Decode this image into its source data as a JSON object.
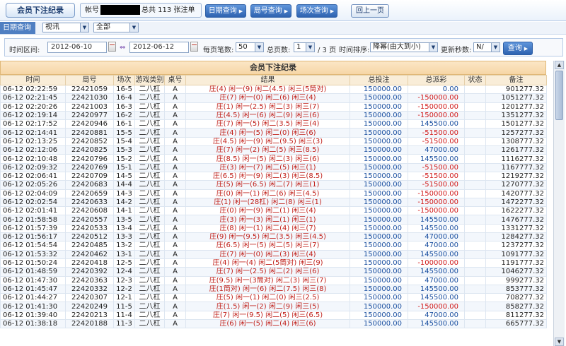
{
  "header": {
    "title": "会员下注纪录",
    "account_label": "帐号",
    "total_text": "总共 113 张注单",
    "buttons": [
      "日期查询",
      "局号查询",
      "场次查询"
    ],
    "back": "回上一页"
  },
  "filter1": {
    "label": "日期查询",
    "select1": "视讯",
    "select2": "全部"
  },
  "filter2": {
    "range_label": "时间区间:",
    "date_from": "2012-06-10",
    "date_to": "2012-06-12",
    "page_size_label": "每页笔数:",
    "page_size": "50",
    "total_pages_label": "总页数:",
    "page": "1",
    "page_count": "/ 3 页",
    "sort_label": "时间排序:",
    "sort_value": "降幂(由大到小)",
    "refresh_label": "更新秒数:",
    "refresh_value": "N/",
    "query_button": "查询"
  },
  "table": {
    "title": "会员下注纪录",
    "columns": [
      "时间",
      "局号",
      "场次",
      "游戏类别",
      "桌号",
      "结果",
      "总投注",
      "总派彩",
      "状态",
      "备注"
    ],
    "rows": [
      [
        "06-12 02:22:59",
        "22421059",
        "16-5",
        "二八杠",
        "A",
        "庄(4) 闲一(9) 闲二(4.5) 闲三(5筒对)",
        "150000.00",
        "0.00",
        "",
        "901277.32"
      ],
      [
        "06-12 02:21:45",
        "22421030",
        "16-4",
        "二八杠",
        "A",
        "庄(7) 闲一(0) 闲二(6) 闲三(4)",
        "150000.00",
        "-150000.00",
        "",
        "1051277.32"
      ],
      [
        "06-12 02:20:26",
        "22421003",
        "16-3",
        "二八杠",
        "A",
        "庄(1) 闲一(2.5) 闲二(3) 闲三(7)",
        "150000.00",
        "-150000.00",
        "",
        "1201277.32"
      ],
      [
        "06-12 02:19:14",
        "22420977",
        "16-2",
        "二八杠",
        "A",
        "庄(4.5) 闲一(6) 闲二(9) 闲三(6)",
        "150000.00",
        "-150000.00",
        "",
        "1351277.32"
      ],
      [
        "06-12 02:17:52",
        "22420946",
        "16-1",
        "二八杠",
        "A",
        "庄(7) 闲一(5) 闲二(3.5) 闲三(4)",
        "150000.00",
        "145500.00",
        "",
        "1501277.32"
      ],
      [
        "06-12 02:14:41",
        "22420881",
        "15-5",
        "二八杠",
        "A",
        "庄(4) 闲一(5) 闲二(0) 闲三(6)",
        "150000.00",
        "-51500.00",
        "",
        "1257277.32"
      ],
      [
        "06-12 02:13:25",
        "22420852",
        "15-4",
        "二八杠",
        "A",
        "庄(4.5) 闲一(9) 闲二(9.5) 闲三(3)",
        "150000.00",
        "-51500.00",
        "",
        "1308777.32"
      ],
      [
        "06-12 02:12:06",
        "22420825",
        "15-3",
        "二八杠",
        "A",
        "庄(7) 闲一(2) 闲二(5) 闲三(8.5)",
        "150000.00",
        "47000.00",
        "",
        "1261777.32"
      ],
      [
        "06-12 02:10:48",
        "22420796",
        "15-2",
        "二八杠",
        "A",
        "庄(8.5) 闲一(5) 闲二(3) 闲三(6)",
        "150000.00",
        "145500.00",
        "",
        "1116277.32"
      ],
      [
        "06-12 02:09:32",
        "22420769",
        "15-1",
        "二八杠",
        "A",
        "庄(3) 闲一(7) 闲二(5) 闲三(1)",
        "150000.00",
        "-51500.00",
        "",
        "1167777.32"
      ],
      [
        "06-12 02:06:41",
        "22420709",
        "14-5",
        "二八杠",
        "A",
        "庄(6.5) 闲一(9) 闲二(3) 闲三(8.5)",
        "150000.00",
        "-51500.00",
        "",
        "1219277.32"
      ],
      [
        "06-12 02:05:26",
        "22420683",
        "14-4",
        "二八杠",
        "A",
        "庄(5) 闲一(6.5) 闲二(7) 闲三(1)",
        "150000.00",
        "-51500.00",
        "",
        "1270777.32"
      ],
      [
        "06-12 02:04:09",
        "22420659",
        "14-3",
        "二八杠",
        "A",
        "庄(0) 闲一(1) 闲二(6) 闲三(4.5)",
        "150000.00",
        "-150000.00",
        "",
        "1420777.32"
      ],
      [
        "06-12 02:02:54",
        "22420633",
        "14-2",
        "二八杠",
        "A",
        "庄(1) 闲一(28杠) 闲二(8) 闲三(1)",
        "150000.00",
        "-150000.00",
        "",
        "1472277.32"
      ],
      [
        "06-12 02:01:41",
        "22420608",
        "14-1",
        "二八杠",
        "A",
        "庄(0) 闲一(9) 闲二(1) 闲三(4)",
        "150000.00",
        "-150000.00",
        "",
        "1622277.32"
      ],
      [
        "06-12 01:58:58",
        "22420557",
        "13-5",
        "二八杠",
        "A",
        "庄(3) 闲一(3) 闲二(1) 闲三(1)",
        "150000.00",
        "145500.00",
        "",
        "1476777.32"
      ],
      [
        "06-12 01:57:39",
        "22420533",
        "13-4",
        "二八杠",
        "A",
        "庄(8) 闲一(1) 闲二(4) 闲三(7)",
        "150000.00",
        "145500.00",
        "",
        "1331277.32"
      ],
      [
        "06-12 01:56:17",
        "22420512",
        "13-3",
        "二八杠",
        "A",
        "庄(9) 闲一(9.5) 闲二(3.5) 闲三(4.5)",
        "150000.00",
        "47000.00",
        "",
        "1284277.32"
      ],
      [
        "06-12 01:54:54",
        "22420485",
        "13-2",
        "二八杠",
        "A",
        "庄(6.5) 闲一(5) 闲二(5) 闲三(7)",
        "150000.00",
        "47000.00",
        "",
        "1237277.32"
      ],
      [
        "06-12 01:53:32",
        "22420462",
        "13-1",
        "二八杠",
        "A",
        "庄(7) 闲一(0) 闲二(3) 闲三(4)",
        "150000.00",
        "145500.00",
        "",
        "1091777.32"
      ],
      [
        "06-12 01:50:24",
        "22420418",
        "12-5",
        "二八杠",
        "A",
        "庄(4) 闲一(4) 闲二(5筒对) 闲三(9)",
        "150000.00",
        "-100000.00",
        "",
        "1191777.32"
      ],
      [
        "06-12 01:48:59",
        "22420392",
        "12-4",
        "二八杠",
        "A",
        "庄(7) 闲一(2.5) 闲二(2) 闲三(6)",
        "150000.00",
        "145500.00",
        "",
        "1046277.32"
      ],
      [
        "06-12 01:47:30",
        "22420363",
        "12-3",
        "二八杠",
        "A",
        "庄(9.5) 闲一(3筒对) 闲二(3) 闲三(7)",
        "150000.00",
        "47000.00",
        "",
        "999277.32"
      ],
      [
        "06-12 01:45:47",
        "22420332",
        "12-2",
        "二八杠",
        "A",
        "庄(1筒对) 闲一(6) 闲二(7.5) 闲三(8)",
        "150000.00",
        "145500.00",
        "",
        "853777.32"
      ],
      [
        "06-12 01:44:27",
        "22420307",
        "12-1",
        "二八杠",
        "A",
        "庄(5) 闲一(1) 闲二(0) 闲三(2.5)",
        "150000.00",
        "145500.00",
        "",
        "708277.32"
      ],
      [
        "06-12 01:41:30",
        "22420249",
        "11-5",
        "二八杠",
        "A",
        "庄(1.5) 闲一(2) 闲二(9) 闲三(5)",
        "150000.00",
        "-150000.00",
        "",
        "858277.32"
      ],
      [
        "06-12 01:39:40",
        "22420213",
        "11-4",
        "二八杠",
        "A",
        "庄(7) 闲一(9.5) 闲二(5) 闲三(6.5)",
        "150000.00",
        "47000.00",
        "",
        "811277.32"
      ],
      [
        "06-12 01:38:18",
        "22420188",
        "11-3",
        "二八杠",
        "A",
        "庄(6) 闲一(5) 闲二(4) 闲三(6)",
        "150000.00",
        "145500.00",
        "",
        "665777.32"
      ]
    ]
  }
}
